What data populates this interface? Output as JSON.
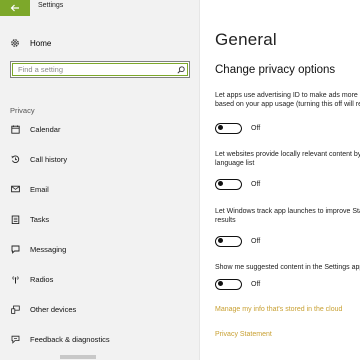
{
  "window": {
    "title": "Settings"
  },
  "nav": {
    "home_label": "Home",
    "search_placeholder": "Find a setting",
    "section_header": "Privacy",
    "items": [
      {
        "label": "Calendar",
        "icon": "calendar-icon"
      },
      {
        "label": "Call history",
        "icon": "call-history-icon"
      },
      {
        "label": "Email",
        "icon": "email-icon"
      },
      {
        "label": "Tasks",
        "icon": "tasks-icon"
      },
      {
        "label": "Messaging",
        "icon": "messaging-icon"
      },
      {
        "label": "Radios",
        "icon": "radios-icon"
      },
      {
        "label": "Other devices",
        "icon": "other-devices-icon"
      },
      {
        "label": "Feedback & diagnostics",
        "icon": "feedback-icon"
      }
    ]
  },
  "main": {
    "page_title": "General",
    "section_title": "Change privacy options",
    "settings": [
      {
        "line1": "Let apps use advertising ID to make ads more interesting to you",
        "line2": "based on your app usage (turning this off will reset your ID)",
        "state": "Off"
      },
      {
        "line1": "Let websites provide locally relevant content by accessing my",
        "line2": "language list",
        "state": "Off"
      },
      {
        "line1": "Let Windows track app launches to improve Start and search",
        "line2": "results",
        "state": "Off"
      },
      {
        "line1": "Show me suggested content in the Settings app",
        "line2": "",
        "state": "Off"
      }
    ],
    "links": {
      "manage_info": "Manage my info that's stored in the cloud",
      "privacy_statement": "Privacy Statement"
    }
  },
  "colors": {
    "accent": "#7da82a",
    "link": "#c8a032",
    "sidebar_bg": "#f2f2f2"
  }
}
